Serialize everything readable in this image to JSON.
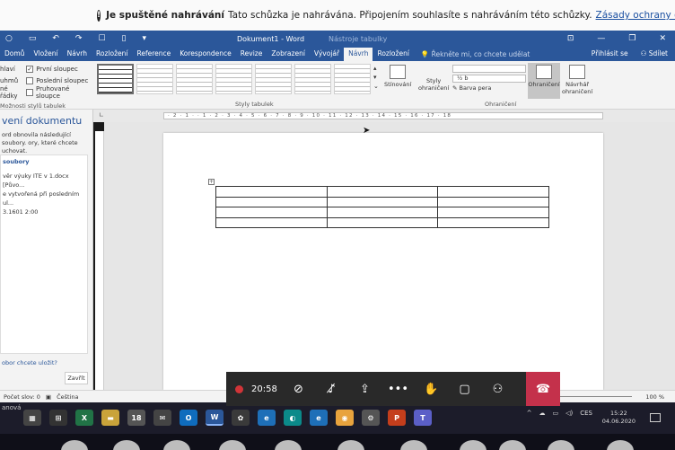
{
  "banner": {
    "bold": "Je spuštěné nahrávání",
    "text": "Tato schůzka je nahrávána. Připojením souhlasíte s nahráváním této schůzky.",
    "link": "Zásady ochrany osobních údajů"
  },
  "titlebar": {
    "title": "Dokument1 - Word",
    "context": "Nástroje tabulky"
  },
  "tabs": [
    "Domů",
    "Vložení",
    "Návrh",
    "Rozložení",
    "Reference",
    "Korespondence",
    "Revize",
    "Zobrazení",
    "Vývojář",
    "Návrh",
    "Rozložení"
  ],
  "active_tab_index": 9,
  "tell_me": "Řekněte mi, co chcete udělat",
  "signin": "Přihlásit se",
  "share": "Sdílet",
  "ribbon": {
    "options": [
      {
        "label": "hlaví",
        "checked": false
      },
      {
        "label": "První sloupec",
        "checked": true
      },
      {
        "label": "uhmů",
        "checked": false
      },
      {
        "label": "Poslední sloupec",
        "checked": false
      },
      {
        "label": "né řádky",
        "checked": false
      },
      {
        "label": "Pruhované sloupce",
        "checked": false
      }
    ],
    "options_group": "Možnosti stylů tabulek",
    "styles_group": "Styly tabulek",
    "shading": "Stínování",
    "border_styles_1": "Styly",
    "border_styles_2": "ohraničení",
    "pen_weight": "½ b",
    "pen_color": "Barva pera",
    "borders": "Ohraničení",
    "painter_1": "Návrhář",
    "painter_2": "ohraničení",
    "borders_group": "Ohraničení"
  },
  "leftpane": {
    "title": "vení dokumentu",
    "desc": "ord obnovila následující soubory. ory, které chcete uchovat.",
    "files_header": "soubory",
    "file_name": "věr výuky ITE v 1.docx  [Půvo...",
    "file_desc": "e vytvořená při posledním ul...",
    "file_time": "3.1601 2:00",
    "question": "obor chcete uložit?",
    "close": "Zavřít"
  },
  "ruler_text": "· 2 · 1 · · 1 · 2 · 3 · 4 · 5 · 6 · 7 · 8 · 9 · 10 · 11 · 12 · 13 · 14 · 15 · 16 · 17 · 18",
  "table": {
    "rows": 4,
    "cols": 3
  },
  "status": {
    "words": "Počet slov: 0",
    "lang": "Čeština",
    "zoom": "100 %"
  },
  "meeting": {
    "timer": "20:58"
  },
  "taskbar": {
    "left_label": "anová",
    "time": "15:22",
    "date": "04.06.2020",
    "lang": "CES"
  }
}
